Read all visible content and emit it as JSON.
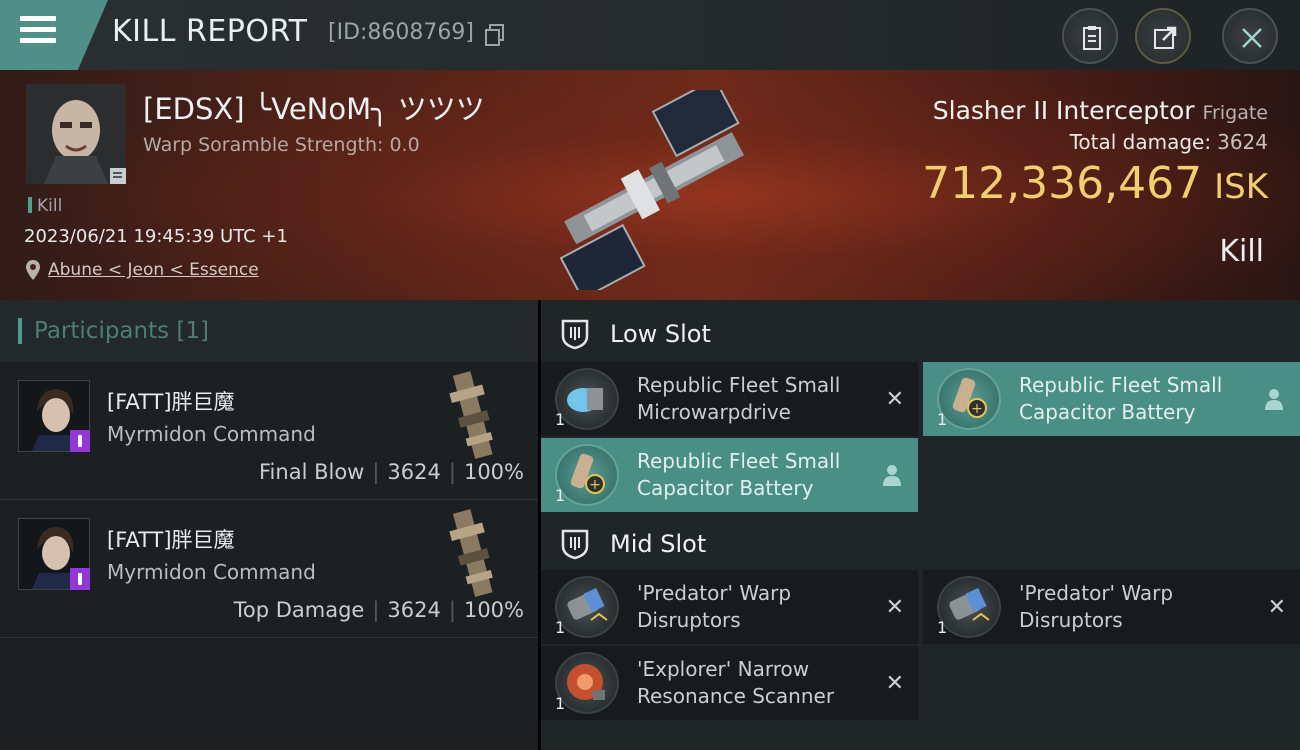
{
  "header": {
    "title": "KILL REPORT",
    "report_id": "[ID:8608769]"
  },
  "victim": {
    "name": "[EDSX] ╰VeNoM╮ ツツツ",
    "warp_scramble": "Warp Soramble Strength: 0.0",
    "result_tag": "Kill",
    "datetime": "2023/06/21 19:45:39 UTC +1",
    "location": "Abune < Jeon < Essence"
  },
  "ship": {
    "name": "Slasher II Interceptor",
    "class": "Frigate",
    "total_damage_label": "Total damage:",
    "total_damage": "3624",
    "isk_value": "712,336,467",
    "isk_unit": "ISK",
    "result": "Kill"
  },
  "participants": {
    "label": "Participants [1]",
    "rows": [
      {
        "name": "[FATT]胖巨魔",
        "ship": "Myrmidon Command",
        "role": "Final Blow",
        "damage": "3624",
        "percent": "100%"
      },
      {
        "name": "[FATT]胖巨魔",
        "ship": "Myrmidon Command",
        "role": "Top Damage",
        "damage": "3624",
        "percent": "100%"
      }
    ]
  },
  "slots": {
    "low": {
      "label": "Low Slot",
      "items": [
        {
          "qty": "1",
          "name": "Republic Fleet Small Microwarpdrive",
          "state": "destroyed"
        },
        {
          "qty": "1",
          "name": "Republic Fleet Small Capacitor Battery",
          "state": "dropped"
        },
        {
          "qty": "1",
          "name": "Republic Fleet Small Capacitor Battery",
          "state": "dropped"
        }
      ]
    },
    "mid": {
      "label": "Mid Slot",
      "items": [
        {
          "qty": "1",
          "name": "'Predator' Warp Disruptors",
          "state": "destroyed"
        },
        {
          "qty": "1",
          "name": "'Predator' Warp Disruptors",
          "state": "destroyed"
        },
        {
          "qty": "1",
          "name": "'Explorer' Narrow Resonance Scanner",
          "state": "destroyed"
        }
      ]
    }
  },
  "colors": {
    "accent_teal": "#4a8f86",
    "isk_gold": "#f1ce6e",
    "corp_badge": "#9437d6"
  },
  "icons": [
    "hamburger-menu-icon",
    "copy-icon",
    "clipboard-icon",
    "share-icon",
    "close-icon",
    "pin-icon",
    "shield-icon",
    "close-x-icon",
    "person-icon"
  ]
}
